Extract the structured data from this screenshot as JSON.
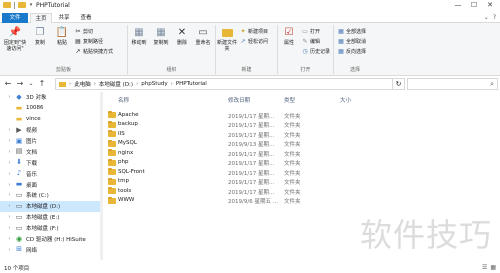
{
  "window": {
    "title": "PHPTutorial",
    "controls": [
      "—",
      "☐",
      "✕"
    ]
  },
  "tabs": [
    "文件",
    "主页",
    "共享",
    "查看"
  ],
  "ribbon": {
    "clipboard": {
      "pin_label": "固定到\"快速访问\"",
      "copy": "复制",
      "paste": "粘贴",
      "cut": "剪切",
      "copy_path": "复制路径",
      "paste_shortcut": "粘贴快捷方式",
      "group_label": "剪贴板"
    },
    "organize": {
      "move_to": "移动到",
      "copy_to": "复制到",
      "delete": "删除",
      "rename": "重命名",
      "group_label": "组织"
    },
    "new": {
      "new_folder": "新建文件夹",
      "new_item": "新建项目",
      "easy_access": "轻松访问",
      "group_label": "新建"
    },
    "open": {
      "properties": "属性",
      "open": "打开",
      "edit": "编辑",
      "history": "历史记录",
      "group_label": "打开"
    },
    "select": {
      "select_all": "全部选择",
      "select_none": "全部取消",
      "invert": "反向选择",
      "group_label": "选择"
    }
  },
  "breadcrumb": [
    "此电脑",
    "本地磁盘 (D:)",
    "phpStudy",
    "PHPTutorial"
  ],
  "columns": {
    "name": "名称",
    "date": "修改日期",
    "type": "类型",
    "size": "大小"
  },
  "files": [
    {
      "name": "Apache",
      "date": "2019/1/17 星期...",
      "type": "文件夹"
    },
    {
      "name": "backup",
      "date": "2019/1/17 星期...",
      "type": "文件夹"
    },
    {
      "name": "IIS",
      "date": "2019/1/17 星期...",
      "type": "文件夹"
    },
    {
      "name": "MySQL",
      "date": "2019/9/13 星期...",
      "type": "文件夹"
    },
    {
      "name": "nginx",
      "date": "2019/1/17 星期...",
      "type": "文件夹"
    },
    {
      "name": "php",
      "date": "2019/1/17 星期...",
      "type": "文件夹"
    },
    {
      "name": "SQL-Front",
      "date": "2019/1/17 星期...",
      "type": "文件夹"
    },
    {
      "name": "tmp",
      "date": "2019/1/17 星期...",
      "type": "文件夹"
    },
    {
      "name": "tools",
      "date": "2019/1/17 星期...",
      "type": "文件夹"
    },
    {
      "name": "WWW",
      "date": "2019/9/6 星期五 ...",
      "type": "文件夹"
    }
  ],
  "sidebar": [
    {
      "label": "3D 对象",
      "icon": "cube-icon",
      "expand": "›",
      "selected": false
    },
    {
      "label": "10086",
      "icon": "folder-icon",
      "expand": "",
      "selected": false
    },
    {
      "label": "vince",
      "icon": "folder-icon",
      "expand": "",
      "selected": false
    },
    {
      "label": "视频",
      "icon": "video-icon",
      "expand": "›",
      "selected": false
    },
    {
      "label": "图片",
      "icon": "picture-icon",
      "expand": "›",
      "selected": false
    },
    {
      "label": "文档",
      "icon": "document-icon",
      "expand": "›",
      "selected": false
    },
    {
      "label": "下载",
      "icon": "download-icon",
      "expand": "›",
      "selected": false
    },
    {
      "label": "音乐",
      "icon": "music-icon",
      "expand": "›",
      "selected": false
    },
    {
      "label": "桌面",
      "icon": "desktop-icon",
      "expand": "›",
      "selected": false
    },
    {
      "label": "系统 (C:)",
      "icon": "drive-icon",
      "expand": "›",
      "selected": false
    },
    {
      "label": "本地磁盘 (D:)",
      "icon": "drive-icon",
      "expand": "›",
      "selected": true
    },
    {
      "label": "本地磁盘 (E:)",
      "icon": "drive-icon",
      "expand": "›",
      "selected": false
    },
    {
      "label": "本地磁盘 (F:)",
      "icon": "drive-icon",
      "expand": "›",
      "selected": false
    },
    {
      "label": "CD 驱动器 (H:) HiSuite",
      "icon": "cd-icon",
      "expand": "›",
      "selected": false
    },
    {
      "label": "网络",
      "icon": "network-icon",
      "expand": "›",
      "selected": false
    }
  ],
  "status": {
    "item_count": "10 个项目"
  },
  "watermark": "软件技巧",
  "colors": {
    "accent": "#1979ca",
    "folder": "#e8b738",
    "selected_bg": "#cce8ff"
  }
}
